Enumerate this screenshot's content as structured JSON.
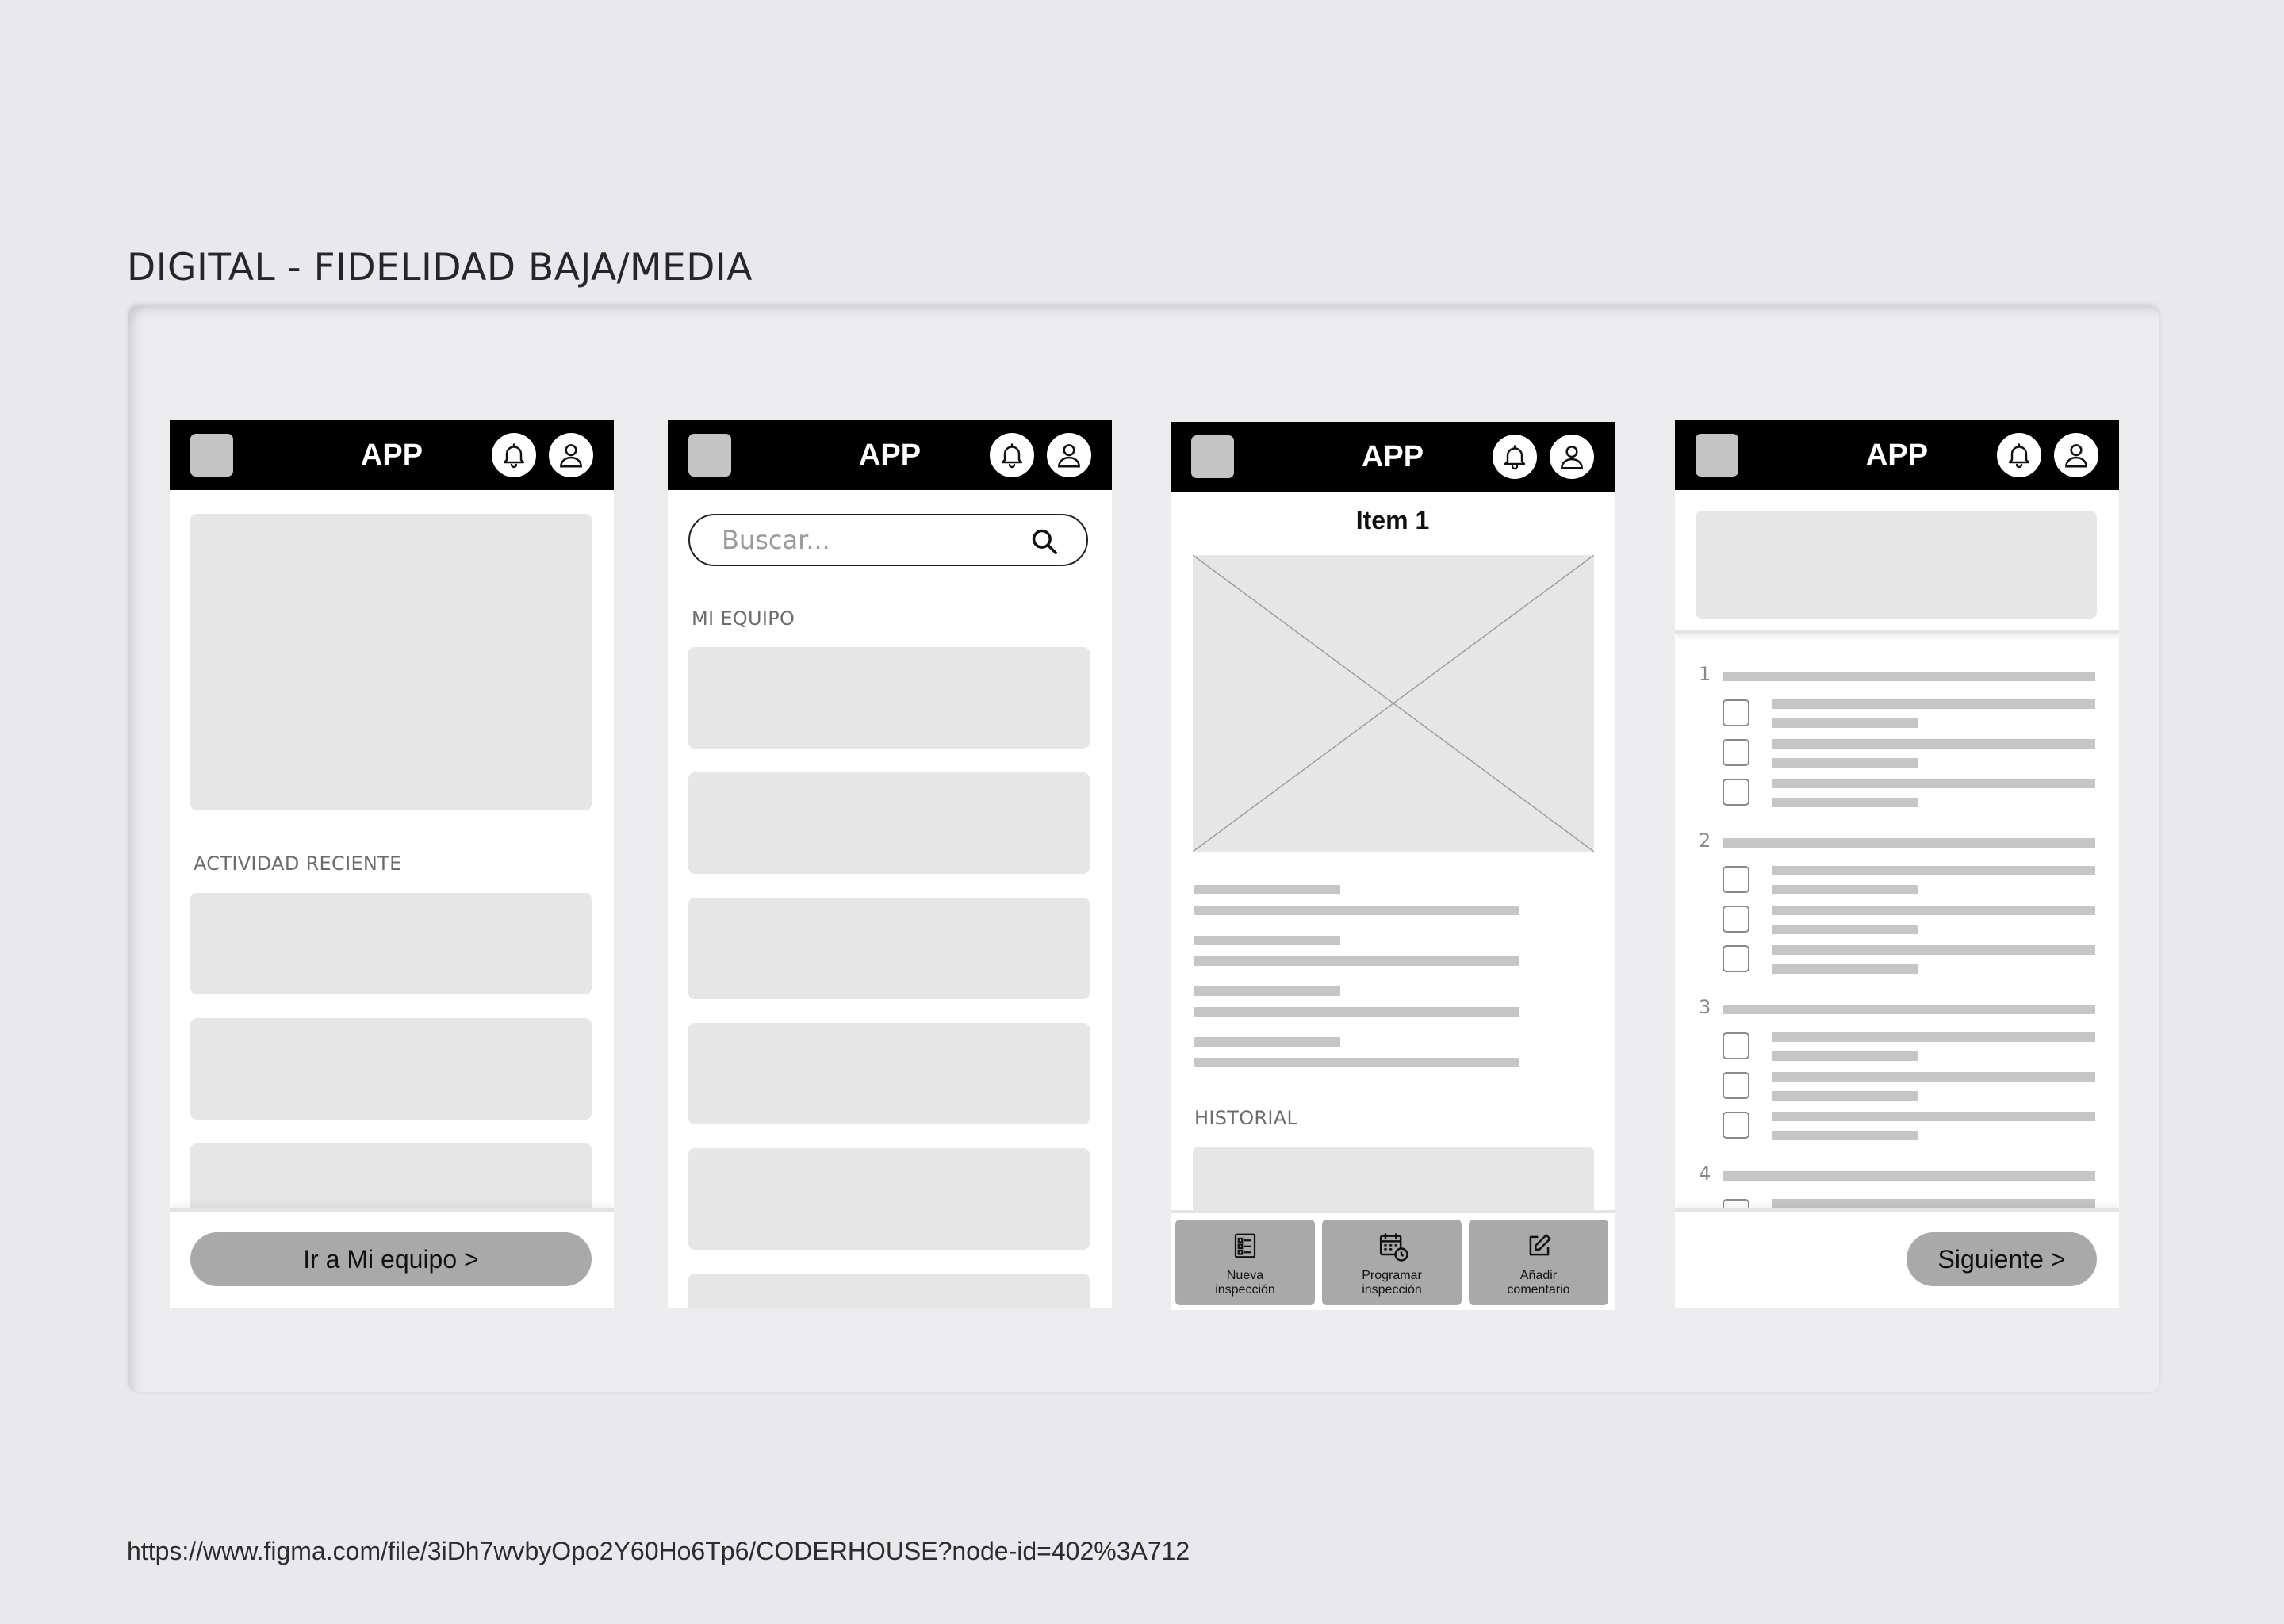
{
  "page": {
    "title": "DIGITAL - FIDELIDAD BAJA/MEDIA",
    "link": "https://www.figma.com/file/3iDh7wvbyOpo2Y60Ho6Tp6/CODERHOUSE?node-id=402%3A712"
  },
  "screens": [
    {
      "appbar": {
        "title": "APP",
        "icons": [
          "menu-placeholder",
          "bell-icon",
          "user-icon"
        ]
      },
      "section_label": "ACTIVIDAD RECIENTE",
      "button": "Ir a Mi equipo >"
    },
    {
      "appbar": {
        "title": "APP",
        "icons": [
          "menu-placeholder",
          "bell-icon",
          "user-icon"
        ]
      },
      "search": {
        "placeholder": "Buscar..."
      },
      "section_label": "MI EQUIPO"
    },
    {
      "appbar": {
        "title": "APP",
        "icons": [
          "menu-placeholder",
          "bell-icon",
          "user-icon"
        ]
      },
      "item_title": "Item 1",
      "section_label": "HISTORIAL",
      "actions": [
        {
          "label_1": "Nueva",
          "label_2": "inspección",
          "icon": "checklist-icon"
        },
        {
          "label_1": "Programar",
          "label_2": "inspección",
          "icon": "calendar-clock-icon"
        },
        {
          "label_1": "Añadir",
          "label_2": "comentario",
          "icon": "edit-icon"
        }
      ]
    },
    {
      "appbar": {
        "title": "APP",
        "icons": [
          "menu-placeholder",
          "bell-icon",
          "user-icon"
        ]
      },
      "question_numbers": [
        "1",
        "2",
        "3",
        "4"
      ],
      "button": "Siguiente >"
    }
  ]
}
